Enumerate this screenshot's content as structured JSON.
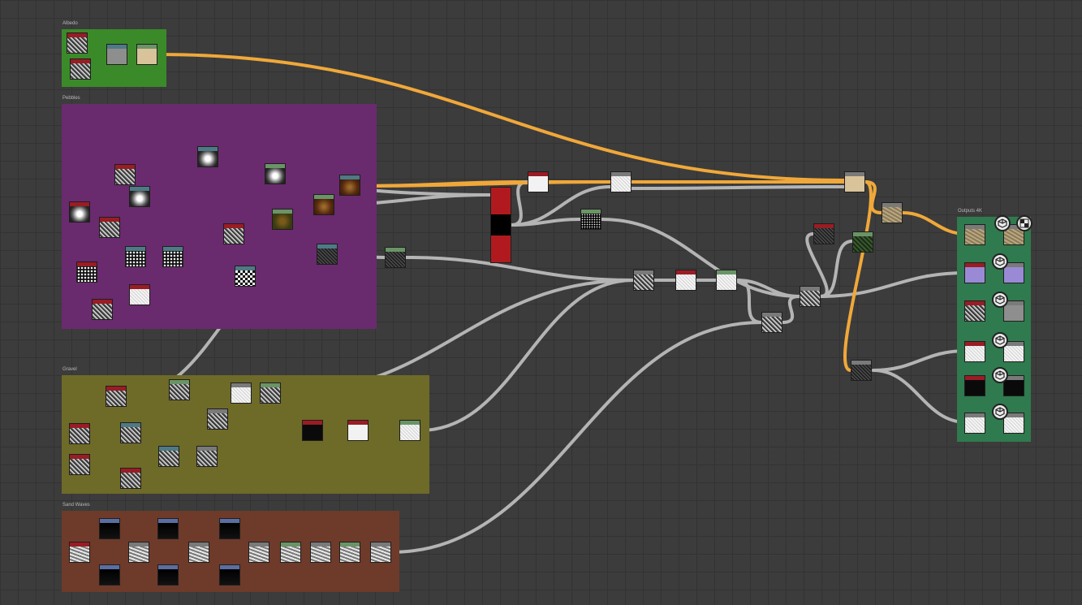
{
  "frames": [
    {
      "id": "albedo",
      "title": "Albedo",
      "color": "#3b8a2a"
    },
    {
      "id": "pebbles",
      "title": "Pebbles",
      "color": "#6a2a6e"
    },
    {
      "id": "gravel",
      "title": "Gravel",
      "color": "#6e6a28"
    },
    {
      "id": "sand-waves",
      "title": "Sand Waves",
      "color": "#6e3a2a"
    },
    {
      "id": "outputs",
      "title": "Outputs 4K",
      "color": "#2f7a4e"
    }
  ],
  "header_colors": {
    "red": "#9a1c24",
    "teal": "#4e7a86",
    "green": "#6a9466",
    "gray": "#7a7a7a",
    "blue": "#5a6ea0"
  },
  "link_colors": {
    "gray": "#b4b4b4",
    "orange": "#f0a83a"
  },
  "output_icons": [
    "cube-icon",
    "cube-icon",
    "cube-icon",
    "cube-icon",
    "cube-icon",
    "cube-icon"
  ],
  "extra_output_icon": "checker-icon"
}
